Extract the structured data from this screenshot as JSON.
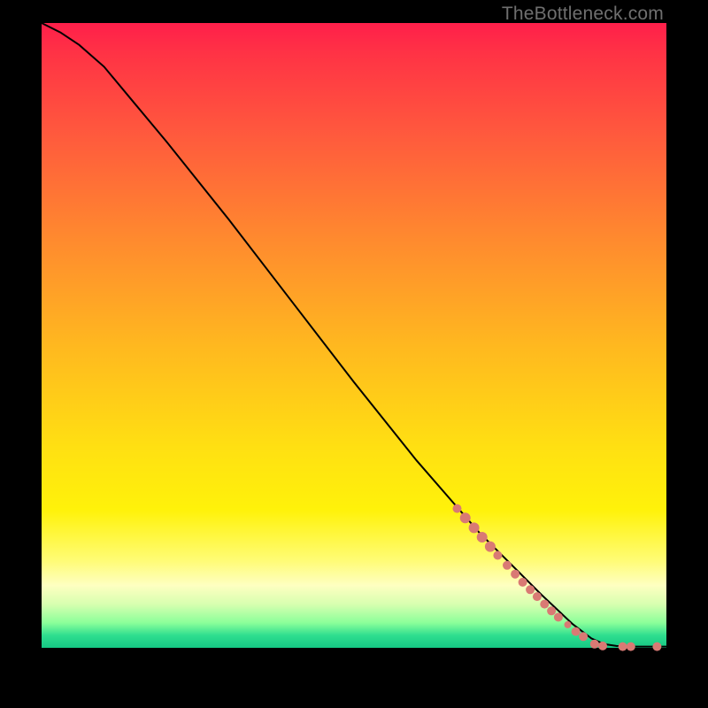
{
  "watermark": "TheBottleneck.com",
  "chart_data": {
    "type": "line",
    "title": "",
    "xlabel": "",
    "ylabel": "",
    "xlim": [
      0,
      100
    ],
    "ylim": [
      0,
      100
    ],
    "curve": [
      {
        "x": 0,
        "y": 100
      },
      {
        "x": 3,
        "y": 98.5
      },
      {
        "x": 6,
        "y": 96.5
      },
      {
        "x": 10,
        "y": 93
      },
      {
        "x": 15,
        "y": 87
      },
      {
        "x": 20,
        "y": 81
      },
      {
        "x": 30,
        "y": 68.5
      },
      {
        "x": 40,
        "y": 55.5
      },
      {
        "x": 50,
        "y": 42.5
      },
      {
        "x": 60,
        "y": 30
      },
      {
        "x": 70,
        "y": 18.5
      },
      {
        "x": 80,
        "y": 8.5
      },
      {
        "x": 85,
        "y": 3.8
      },
      {
        "x": 88,
        "y": 1.5
      },
      {
        "x": 90,
        "y": 0.6
      },
      {
        "x": 92,
        "y": 0.3
      },
      {
        "x": 95,
        "y": 0.2
      },
      {
        "x": 100,
        "y": 0.2
      }
    ],
    "dots": [
      {
        "x": 66.5,
        "y": 22.3,
        "r": 5
      },
      {
        "x": 67.8,
        "y": 20.8,
        "r": 6
      },
      {
        "x": 69.2,
        "y": 19.2,
        "r": 6
      },
      {
        "x": 70.5,
        "y": 17.7,
        "r": 6
      },
      {
        "x": 71.8,
        "y": 16.2,
        "r": 6
      },
      {
        "x": 73.0,
        "y": 14.8,
        "r": 5
      },
      {
        "x": 74.5,
        "y": 13.2,
        "r": 5
      },
      {
        "x": 75.8,
        "y": 11.8,
        "r": 5
      },
      {
        "x": 77.0,
        "y": 10.5,
        "r": 5
      },
      {
        "x": 78.2,
        "y": 9.3,
        "r": 5
      },
      {
        "x": 79.3,
        "y": 8.2,
        "r": 5
      },
      {
        "x": 80.5,
        "y": 7.0,
        "r": 5
      },
      {
        "x": 81.6,
        "y": 5.9,
        "r": 5
      },
      {
        "x": 82.7,
        "y": 4.9,
        "r": 5
      },
      {
        "x": 84.2,
        "y": 3.7,
        "r": 4
      },
      {
        "x": 85.5,
        "y": 2.6,
        "r": 5
      },
      {
        "x": 86.7,
        "y": 1.8,
        "r": 5
      },
      {
        "x": 88.5,
        "y": 0.6,
        "r": 5
      },
      {
        "x": 89.8,
        "y": 0.3,
        "r": 5
      },
      {
        "x": 93.0,
        "y": 0.2,
        "r": 5
      },
      {
        "x": 94.3,
        "y": 0.2,
        "r": 5
      },
      {
        "x": 98.5,
        "y": 0.2,
        "r": 5
      }
    ]
  }
}
